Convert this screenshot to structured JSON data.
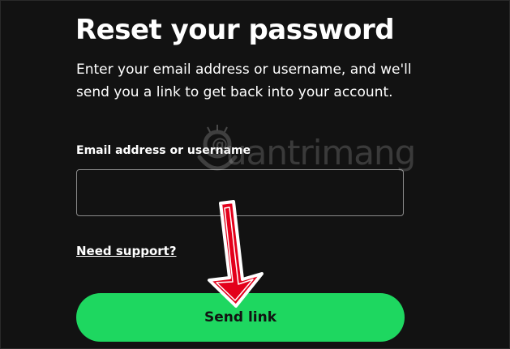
{
  "form": {
    "title": "Reset your password",
    "intro": "Enter your email address or username, and we'll send you a link to get back into your account.",
    "email_label": "Email address or username",
    "email_value": "",
    "support_link": "Need support?",
    "send_button": "Send link"
  },
  "watermark": {
    "text": "uantrimang"
  },
  "colors": {
    "background": "#121212",
    "text": "#ffffff",
    "accent": "#1ed760",
    "input_border": "#8a8a8a",
    "annotation_arrow": "#e3001b"
  }
}
